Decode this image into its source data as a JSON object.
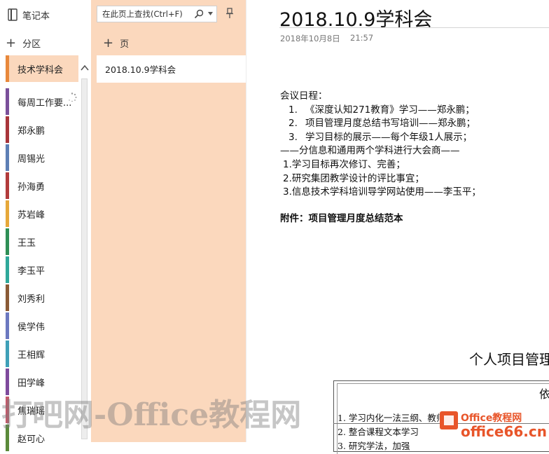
{
  "notebook": {
    "title": "笔记本"
  },
  "sections": {
    "add_label": "分区",
    "items": [
      {
        "label": "技术学科会",
        "color": "#e8883b",
        "active": true
      },
      {
        "label": "每周工作要...",
        "color": "#7a4f9a",
        "active": false
      },
      {
        "label": "郑永鹏",
        "color": "#a8353a",
        "active": false
      },
      {
        "label": "周锡光",
        "color": "#5d7fb5",
        "active": false
      },
      {
        "label": "孙海勇",
        "color": "#b23b3b",
        "active": false
      },
      {
        "label": "苏岩峰",
        "color": "#e6a83a",
        "active": false
      },
      {
        "label": "王玉",
        "color": "#2e8f55",
        "active": false
      },
      {
        "label": "李玉平",
        "color": "#2fa89a",
        "active": false
      },
      {
        "label": "刘秀利",
        "color": "#8a5a36",
        "active": false
      },
      {
        "label": "侯学伟",
        "color": "#6b78c0",
        "active": false
      },
      {
        "label": "王相辉",
        "color": "#3fa0b8",
        "active": false
      },
      {
        "label": "田学峰",
        "color": "#7e4a9c",
        "active": false
      },
      {
        "label": "焦瑞瑶",
        "color": "#c45a6b",
        "active": false
      },
      {
        "label": "赵可心",
        "color": "#5a8a3a",
        "active": false
      }
    ]
  },
  "pages": {
    "search_placeholder": "在此页上查找(Ctrl+F)",
    "add_label": "页",
    "items": [
      {
        "label": "2018.10.9学科会"
      }
    ]
  },
  "page": {
    "title": "2018.10.9学科会",
    "date": "2018年10月8日",
    "time": "21:57",
    "agenda_heading": "会议日程：",
    "agenda": [
      {
        "num": "1.",
        "text": "《深度认知271教育》学习——郑永鹏；"
      },
      {
        "num": "2.",
        "text": "项目管理月度总结书写培训——郑永鹏；"
      },
      {
        "num": "3.",
        "text": "学习目标的展示——每个年级1人展示；"
      }
    ],
    "split_line": "——分信息和通用两个学科进行大会商——",
    "sub_items": [
      "1.学习目标再次修订、完善；",
      "2.研究集团教学设计的评比事宜；",
      "3.信息技术学科培训导学网站使用——李玉平；"
    ],
    "attachment": "附件：项目管理月度总结范本"
  },
  "embedded_doc": {
    "title": "个人项目管理",
    "header_char": "依",
    "line1": "1.  学习内化一法三纲、教师课",
    "line2": "2.  整合课程文本学习",
    "line3": "3.  研究学法，加强"
  },
  "watermarks": {
    "text": "打吧网-Office教程网",
    "logo": "office66.cn",
    "logo_brand": "Office教程网"
  }
}
